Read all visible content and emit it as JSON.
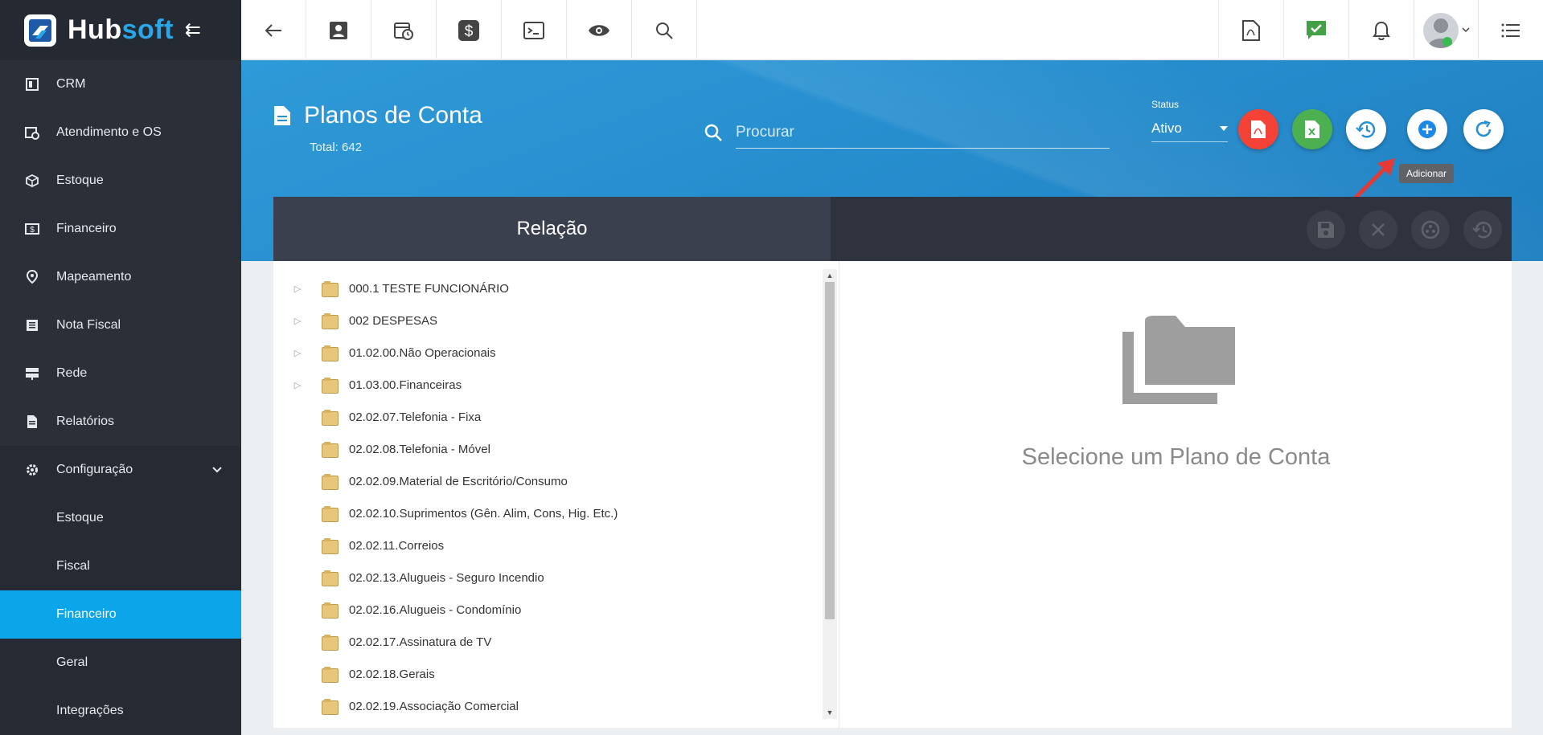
{
  "app": {
    "brand_hub": "Hub",
    "brand_soft": "soft"
  },
  "sidebar": {
    "items": [
      {
        "label": "CRM",
        "icon": "crm-icon"
      },
      {
        "label": "Atendimento e OS",
        "icon": "calendar-clock-icon"
      },
      {
        "label": "Estoque",
        "icon": "box-icon"
      },
      {
        "label": "Financeiro",
        "icon": "money-icon"
      },
      {
        "label": "Mapeamento",
        "icon": "map-pin-icon"
      },
      {
        "label": "Nota Fiscal",
        "icon": "receipt-icon"
      },
      {
        "label": "Rede",
        "icon": "server-icon"
      },
      {
        "label": "Relatórios",
        "icon": "report-icon"
      },
      {
        "label": "Configuração",
        "icon": "gear-icon"
      }
    ],
    "submenu": [
      "Estoque",
      "Fiscal",
      "Financeiro",
      "Geral",
      "Integrações"
    ],
    "active_submenu": "Financeiro"
  },
  "header": {
    "title": "Planos de Conta",
    "total": "Total: 642",
    "search_placeholder": "Procurar",
    "status_label": "Status",
    "status_value": "Ativo",
    "tooltip": "Adicionar"
  },
  "panel": {
    "left_title": "Relação",
    "empty_text": "Selecione um Plano de Conta"
  },
  "tree": [
    {
      "label": "000.1 TESTE FUNCIONÁRIO",
      "expandable": true
    },
    {
      "label": "002 DESPESAS",
      "expandable": true
    },
    {
      "label": "01.02.00.Não Operacionais",
      "expandable": true
    },
    {
      "label": "01.03.00.Financeiras",
      "expandable": true
    },
    {
      "label": "02.02.07.Telefonia - Fixa",
      "expandable": false
    },
    {
      "label": "02.02.08.Telefonia - Móvel",
      "expandable": false
    },
    {
      "label": "02.02.09.Material de Escritório/Consumo",
      "expandable": false
    },
    {
      "label": "02.02.10.Suprimentos (Gên. Alim, Cons, Hig. Etc.)",
      "expandable": false
    },
    {
      "label": "02.02.11.Correios",
      "expandable": false
    },
    {
      "label": "02.02.13.Alugueis - Seguro Incendio",
      "expandable": false
    },
    {
      "label": "02.02.16.Alugueis - Condomínio",
      "expandable": false
    },
    {
      "label": "02.02.17.Assinatura de TV",
      "expandable": false
    },
    {
      "label": "02.02.18.Gerais",
      "expandable": false
    },
    {
      "label": "02.02.19.Associação Comercial",
      "expandable": false
    }
  ]
}
